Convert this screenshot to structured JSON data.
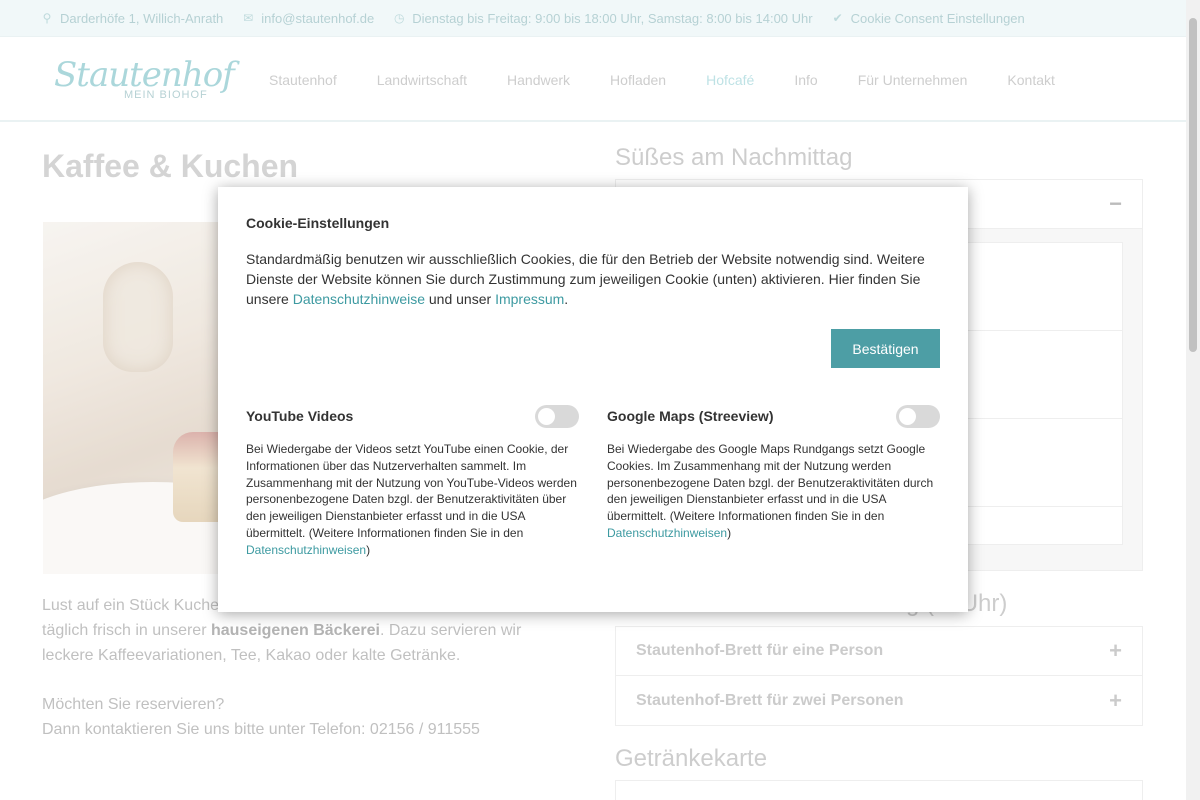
{
  "topbar": {
    "address": "Darderhöfe 1, Willich-Anrath",
    "email": "info@stautenhof.de",
    "hours": "Dienstag bis Freitag: 9:00 bis 18:00 Uhr, Samstag: 8:00 bis 14:00 Uhr",
    "cookie_link": "Cookie Consent Einstellungen"
  },
  "logo": {
    "script": "Stautenhof",
    "sub": "MEIN BIOHOF"
  },
  "nav": {
    "items": [
      {
        "label": "Stautenhof"
      },
      {
        "label": "Landwirtschaft"
      },
      {
        "label": "Handwerk"
      },
      {
        "label": "Hofladen"
      },
      {
        "label": "Hofcafé"
      },
      {
        "label": "Info"
      },
      {
        "label": "Für Unternehmen"
      },
      {
        "label": "Kontakt"
      }
    ],
    "active": "Hofcafé"
  },
  "main": {
    "title": "Kaffee & Kuchen",
    "para1_a": "Lust auf ein Stück Kuche",
    "para1_b": "täglich frisch in unserer ",
    "para1_bold": "hauseigenen Bäckerei",
    "para1_c": ". Dazu servieren wir",
    "para1_d": "leckere Kaffeevariationen, Tee, Kakao oder kalte Getränke.",
    "para2_a": "Möchten Sie reservieren?",
    "para2_b": "Dann kontaktieren Sie uns bitte unter Telefon: 02156 / 911555"
  },
  "right": {
    "section1_title": "Süßes am Nachmittag",
    "section1_toggle": "−",
    "section2_title_tail": "g (   4 Uhr)",
    "section2_items": [
      {
        "label": "Stautenhof-Brett für eine Person",
        "toggle": "+"
      },
      {
        "label": "Stautenhof-Brett für zwei Personen",
        "toggle": "+"
      }
    ],
    "section3_title": "Getränkekarte"
  },
  "modal": {
    "title": "Cookie-Einstellungen",
    "text_a": "Standardmäßig benutzen wir ausschließlich Cookies, die für den Betrieb der Website notwendig sind. Weitere Dienste der Website können Sie durch Zustimmung zum jeweiligen Cookie (unten) aktivieren. Hier finden Sie unsere ",
    "link_privacy": "Datenschutzhinweise",
    "text_b": " und unser ",
    "link_imprint": "Impressum",
    "text_c": ".",
    "confirm_label": "Bestätigen",
    "services": [
      {
        "name": "YouTube Videos",
        "enabled": false,
        "desc": "Bei Wiedergabe der Videos setzt YouTube einen Cookie, der Informationen über das Nutzerverhalten sammelt. Im Zusammenhang mit der Nutzung von YouTube-Videos werden personenbezogene Daten bzgl. der Benutzeraktivitäten über den jeweiligen Dienstanbieter erfasst und in die USA übermittelt. (Weitere Informationen finden Sie in den ",
        "link": "Datenschutzhinweisen",
        "tail": ")"
      },
      {
        "name": "Google Maps (Streeview)",
        "enabled": false,
        "desc": "Bei Wiedergabe des Google Maps Rundgangs setzt Google Cookies. Im Zusammenhang mit der Nutzung werden personenbezogene Daten bzgl. der Benutzeraktivitäten durch den jeweiligen Dienstanbieter erfasst und in die USA übermittelt. (Weitere Informationen finden Sie in den ",
        "link": "Datenschutzhinweisen",
        "tail": ")"
      }
    ]
  },
  "colors": {
    "accent": "#4d9ea5",
    "link": "#3d9aa1",
    "topbar_bg": "#eaf5f6"
  }
}
